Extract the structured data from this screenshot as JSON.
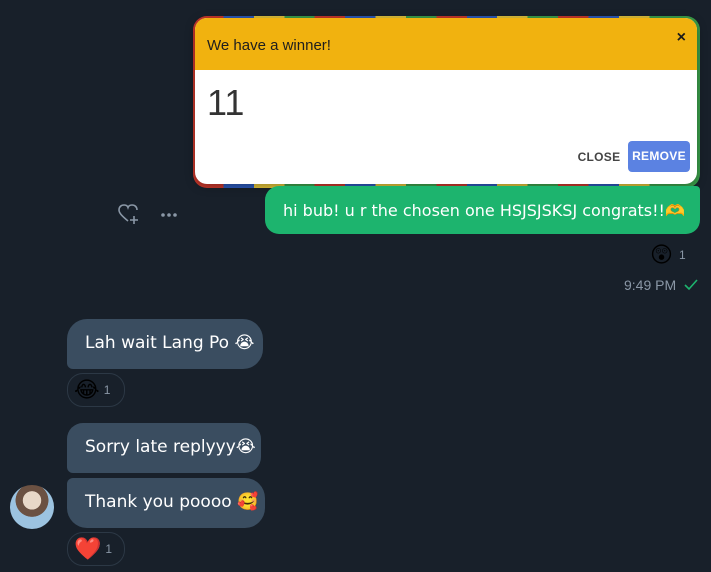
{
  "dialog": {
    "title": "We have a winner!",
    "close_symbol": "×",
    "result": "11",
    "close_button": "CLOSE",
    "remove_button": "REMOVE"
  },
  "sent": {
    "text": "hi bub! u r the chosen one HSJSJSKSJ congrats!!🫶",
    "reaction_emoji": "😲",
    "reaction_count": "1",
    "time": "9:49 PM"
  },
  "received": [
    {
      "text": "Lah wait Lang Po 😭",
      "reaction_emoji": "😂",
      "reaction_count": "1"
    },
    {
      "text": "Sorry late replyyy😭"
    },
    {
      "text": "Thank you poooo 🥰",
      "reaction_emoji": "❤️",
      "reaction_count": "1"
    }
  ],
  "colors": {
    "background": "#18202a",
    "dialog_header": "#f1b20f",
    "remove_button": "#5b82e2",
    "sent_bubble": "#1db46e",
    "received_bubble": "#3a4d60"
  },
  "icons": [
    "heart-add-icon",
    "more-icon",
    "check-icon",
    "close-icon"
  ]
}
